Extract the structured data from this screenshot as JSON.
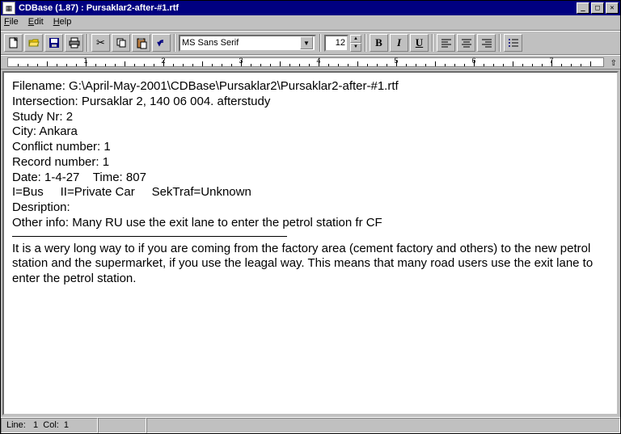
{
  "titlebar": {
    "text": "CDBase (1.87) : Pursaklar2-after-#1.rtf"
  },
  "menu": {
    "file": "File",
    "edit": "Edit",
    "help": "Help"
  },
  "toolbar": {
    "font_name": "MS Sans Serif",
    "font_size": "12",
    "bold": "B",
    "italic": "I",
    "underline": "U"
  },
  "ruler": {
    "numbers": [
      "1",
      "2",
      "3",
      "4",
      "5",
      "6",
      "7"
    ]
  },
  "doc": {
    "l1_label": "Filename: ",
    "l1_value": "G:\\April-May-2001\\CDBase\\Pursaklar2\\Pursaklar2-after-#1.rtf",
    "l2_label": "Intersection: ",
    "l2_value": "Pursaklar 2, 140 06 004. afterstudy",
    "l3_label": "Study Nr: ",
    "l3_value": "2",
    "l4_label": "City: ",
    "l4_value": "Ankara",
    "l5_label": "Conflict number: ",
    "l5_value": "1",
    "l6_label": "Record number: ",
    "l6_value": "1",
    "l7": "Date: 1-4-27    Time: 807",
    "l8": "I=Bus     II=Private Car     SekTraf=Unknown",
    "l9": "Desription:",
    "l10_label": "Other info: ",
    "l10_value": "Many RU use the exit lane to enter the petrol station fr CF",
    "para": "It is a wery long way to if you are coming from the factory area (cement factory and others) to the new petrol station and the supermarket, if you use the leagal way. This means that many road users use the exit lane to enter the petrol station."
  },
  "status": {
    "cell1": "Line:   1  Col:  1"
  }
}
